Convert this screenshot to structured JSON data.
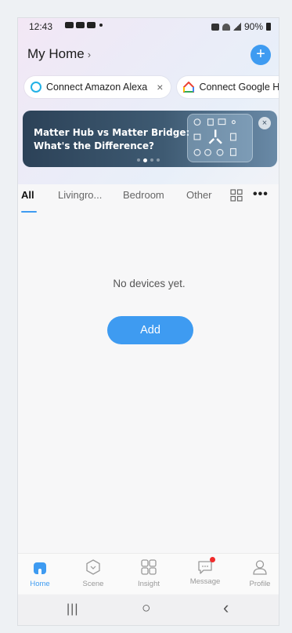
{
  "status_bar": {
    "time": "12:43",
    "battery": "90%"
  },
  "header": {
    "title": "My Home",
    "chevron": "›"
  },
  "chips": [
    {
      "label": "Connect Amazon Alexa",
      "close": "×"
    },
    {
      "label": "Connect Google Home"
    }
  ],
  "banner": {
    "line1": "Matter Hub vs Matter Bridge:",
    "line2": "What's the Difference?",
    "close": "×"
  },
  "tabs": [
    {
      "label": "All"
    },
    {
      "label": "Livingro..."
    },
    {
      "label": "Bedroom"
    },
    {
      "label": "Other"
    }
  ],
  "more_glyph": "•••",
  "empty": {
    "message": "No devices yet.",
    "add_label": "Add"
  },
  "bottom_nav": [
    {
      "label": "Home",
      "icon": "home-icon"
    },
    {
      "label": "Scene",
      "icon": "scene-icon"
    },
    {
      "label": "Insight",
      "icon": "insight-icon"
    },
    {
      "label": "Message",
      "icon": "message-icon"
    },
    {
      "label": "Profile",
      "icon": "profile-icon"
    }
  ],
  "system_nav": {
    "recents": "|||",
    "home": "○",
    "back": "‹"
  },
  "colors": {
    "accent": "#3e9bf1",
    "badge": "#f02b2b"
  }
}
